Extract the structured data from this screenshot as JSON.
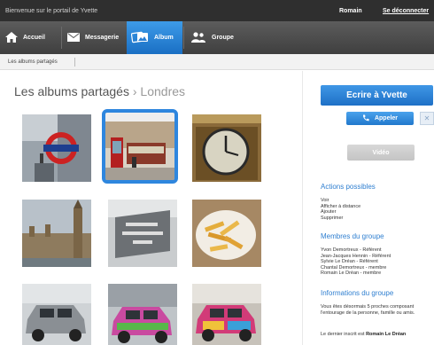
{
  "topbar": {
    "welcome": "Bienvenue sur le portail de Yvette",
    "user": "Romain",
    "logout": "Se déconnecter"
  },
  "nav": {
    "items": [
      {
        "label": "Accueil",
        "icon": "home-icon"
      },
      {
        "label": "Messagerie",
        "icon": "envelope-icon"
      },
      {
        "label": "Album",
        "icon": "photo-album-icon",
        "active": true
      },
      {
        "label": "Groupe",
        "icon": "group-icon"
      }
    ]
  },
  "breadcrumb": {
    "label": "Les albums partagés"
  },
  "page": {
    "title": "Les albums partagés",
    "separator": "›",
    "subtitle": "Londres"
  },
  "album": {
    "photos": [
      {
        "subject": "Underground sign"
      },
      {
        "subject": "Street with red telephone box",
        "selected": true
      },
      {
        "subject": "Big Ben clock face"
      },
      {
        "subject": "Houses of Parliament"
      },
      {
        "subject": "New Scotland Yard sign"
      },
      {
        "subject": "Fish and chips"
      },
      {
        "subject": "London taxi"
      },
      {
        "subject": "Painted taxi"
      },
      {
        "subject": "Painted taxi"
      }
    ]
  },
  "sidebar": {
    "write_button": "Ecrire à Yvette",
    "call_button": "Appeler",
    "video_button": "Vidéo",
    "actions_title": "Actions possibles",
    "actions": [
      "Voir",
      "Afficher à distance",
      "Ajouter",
      "Supprimer"
    ],
    "members_title": "Membres du groupe",
    "members": [
      "Yvon Demortreux - Référent",
      "Jean-Jacques Hennin - Référent",
      "Sylvie Le Dréan - Référent",
      "Chantal Demortreux - membre",
      "Romain Le Dréan - membre"
    ],
    "info_title": "Informations du groupe",
    "info_text": "Vous êtes désormais 5 proches composant l'entourage de la personne, famille ou amis.",
    "last_prefix": "Le dernier inscrit est",
    "last_name": "Romain Le Dréan"
  },
  "colors": {
    "accent": "#2e86de",
    "topbar": "#2f2f2f",
    "navbar": "#4a4a4a",
    "link_blue": "#2f7fd0"
  }
}
